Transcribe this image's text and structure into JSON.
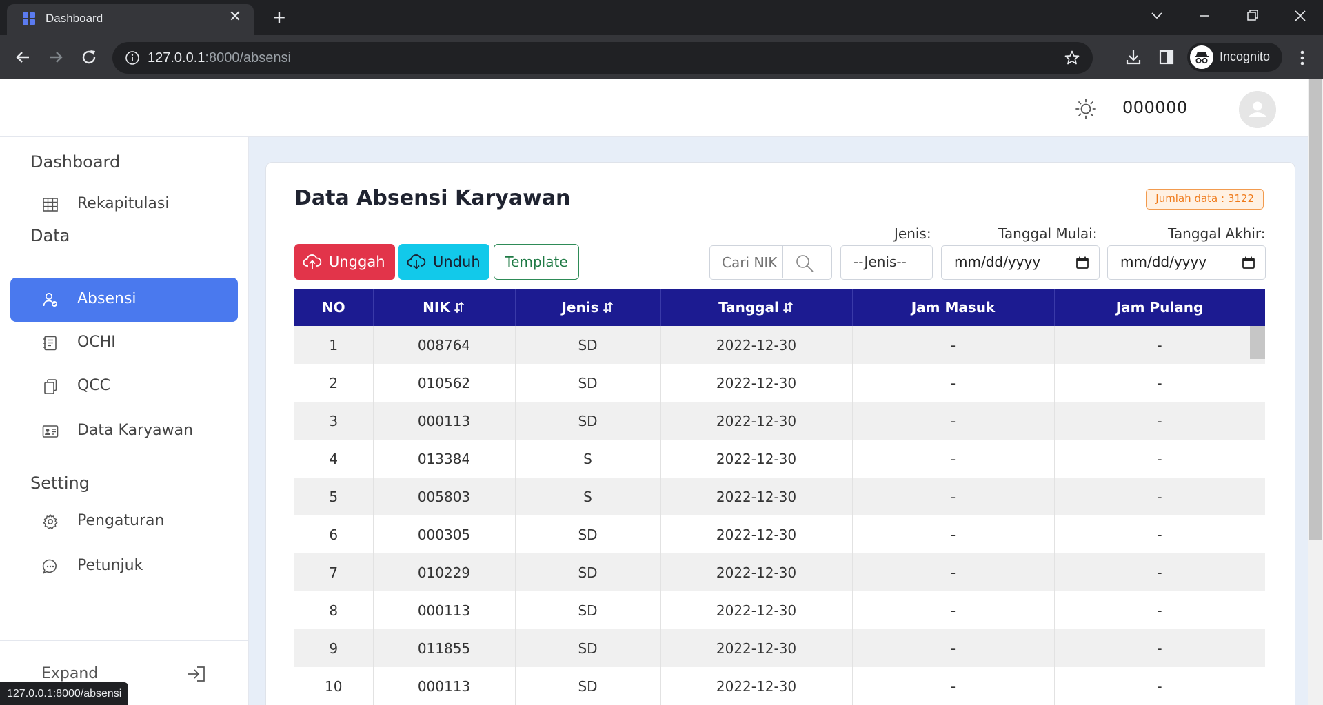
{
  "browser": {
    "tab_title": "Dashboard",
    "url_host": "127.0.0.1",
    "url_path": ":8000/absensi",
    "profile_label": "Incognito",
    "status_url": "127.0.0.1:8000/absensi"
  },
  "header": {
    "user_name": "000000"
  },
  "sidebar": {
    "sections": [
      {
        "label": "Dashboard"
      },
      {
        "label": "Data"
      },
      {
        "label": "Setting"
      }
    ],
    "items": [
      {
        "label": "Rekapitulasi",
        "icon": "table-icon"
      },
      {
        "label": "Absensi",
        "icon": "user-check-icon",
        "active": true
      },
      {
        "label": "OCHI",
        "icon": "notebook-icon"
      },
      {
        "label": "QCC",
        "icon": "copy-icon"
      },
      {
        "label": "Data Karyawan",
        "icon": "id-card-icon"
      },
      {
        "label": "Pengaturan",
        "icon": "gear-icon"
      },
      {
        "label": "Petunjuk",
        "icon": "chat-icon"
      }
    ],
    "expand_label": "Expand"
  },
  "main": {
    "title": "Data Absensi Karyawan",
    "count_badge": "Jumlah data : 3122",
    "buttons": {
      "upload": "Unggah",
      "download": "Unduh",
      "template": "Template"
    },
    "search_placeholder": "Cari NIK",
    "filters": {
      "jenis_label": "Jenis:",
      "jenis_value": "--Jenis--",
      "start_label": "Tanggal Mulai:",
      "start_value": "mm/dd/yyyy",
      "end_label": "Tanggal Akhir:",
      "end_value": "mm/dd/yyyy"
    },
    "colors": {
      "header_bg": "#1c1b91",
      "active_nav": "#4a79ee",
      "upload_btn": "#e2344a",
      "download_btn": "#12c9ea"
    }
  },
  "table": {
    "columns": [
      "NO",
      "NIK",
      "Jenis",
      "Tanggal",
      "Jam Masuk",
      "Jam Pulang"
    ],
    "sortable": [
      false,
      true,
      true,
      true,
      false,
      false
    ],
    "rows": [
      [
        "1",
        "008764",
        "SD",
        "2022-12-30",
        "-",
        "-"
      ],
      [
        "2",
        "010562",
        "SD",
        "2022-12-30",
        "-",
        "-"
      ],
      [
        "3",
        "000113",
        "SD",
        "2022-12-30",
        "-",
        "-"
      ],
      [
        "4",
        "013384",
        "S",
        "2022-12-30",
        "-",
        "-"
      ],
      [
        "5",
        "005803",
        "S",
        "2022-12-30",
        "-",
        "-"
      ],
      [
        "6",
        "000305",
        "SD",
        "2022-12-30",
        "-",
        "-"
      ],
      [
        "7",
        "010229",
        "SD",
        "2022-12-30",
        "-",
        "-"
      ],
      [
        "8",
        "000113",
        "SD",
        "2022-12-30",
        "-",
        "-"
      ],
      [
        "9",
        "011855",
        "SD",
        "2022-12-30",
        "-",
        "-"
      ],
      [
        "10",
        "000113",
        "SD",
        "2022-12-30",
        "-",
        "-"
      ]
    ]
  }
}
